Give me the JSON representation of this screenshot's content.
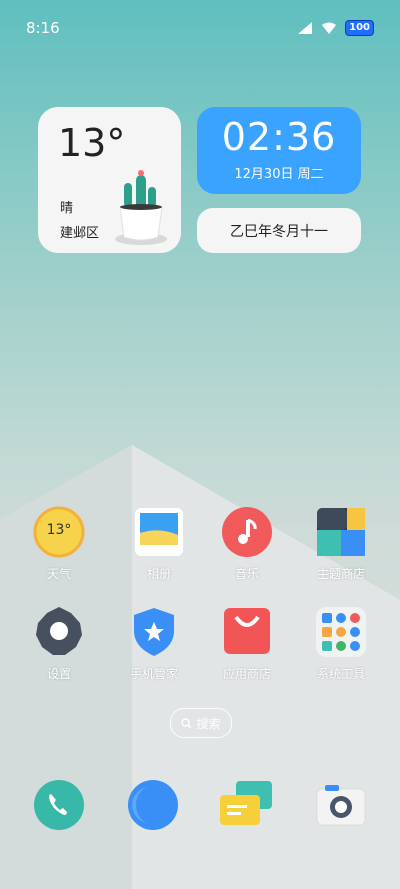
{
  "status_bar": {
    "time": "8:16",
    "battery": "100"
  },
  "weather_widget": {
    "temperature": "13°",
    "condition": "晴",
    "location": "建邺区"
  },
  "clock_widget": {
    "time": "02:36",
    "date": "12月30日 周二",
    "lunar_date": "乙巳年冬月十一"
  },
  "apps": {
    "row1": [
      {
        "label": "天气",
        "icon": "weather-icon",
        "icon_text": "13°"
      },
      {
        "label": "相册",
        "icon": "gallery-icon"
      },
      {
        "label": "音乐",
        "icon": "music-icon"
      },
      {
        "label": "主题商店",
        "icon": "themes-icon"
      }
    ],
    "row2": [
      {
        "label": "设置",
        "icon": "settings-icon"
      },
      {
        "label": "手机管家",
        "icon": "security-icon"
      },
      {
        "label": "应用商店",
        "icon": "app-store-icon"
      },
      {
        "label": "系统工具",
        "icon": "tools-folder-icon"
      }
    ]
  },
  "search": {
    "label": "搜索"
  },
  "dock": [
    "phone-icon",
    "browser-icon",
    "messages-icon",
    "camera-icon"
  ],
  "colors": {
    "clock_bg": "#3aa2ff",
    "music": "#f15a5a",
    "store": "#f25555",
    "security": "#3a8ff7",
    "phone": "#37b8a8"
  }
}
